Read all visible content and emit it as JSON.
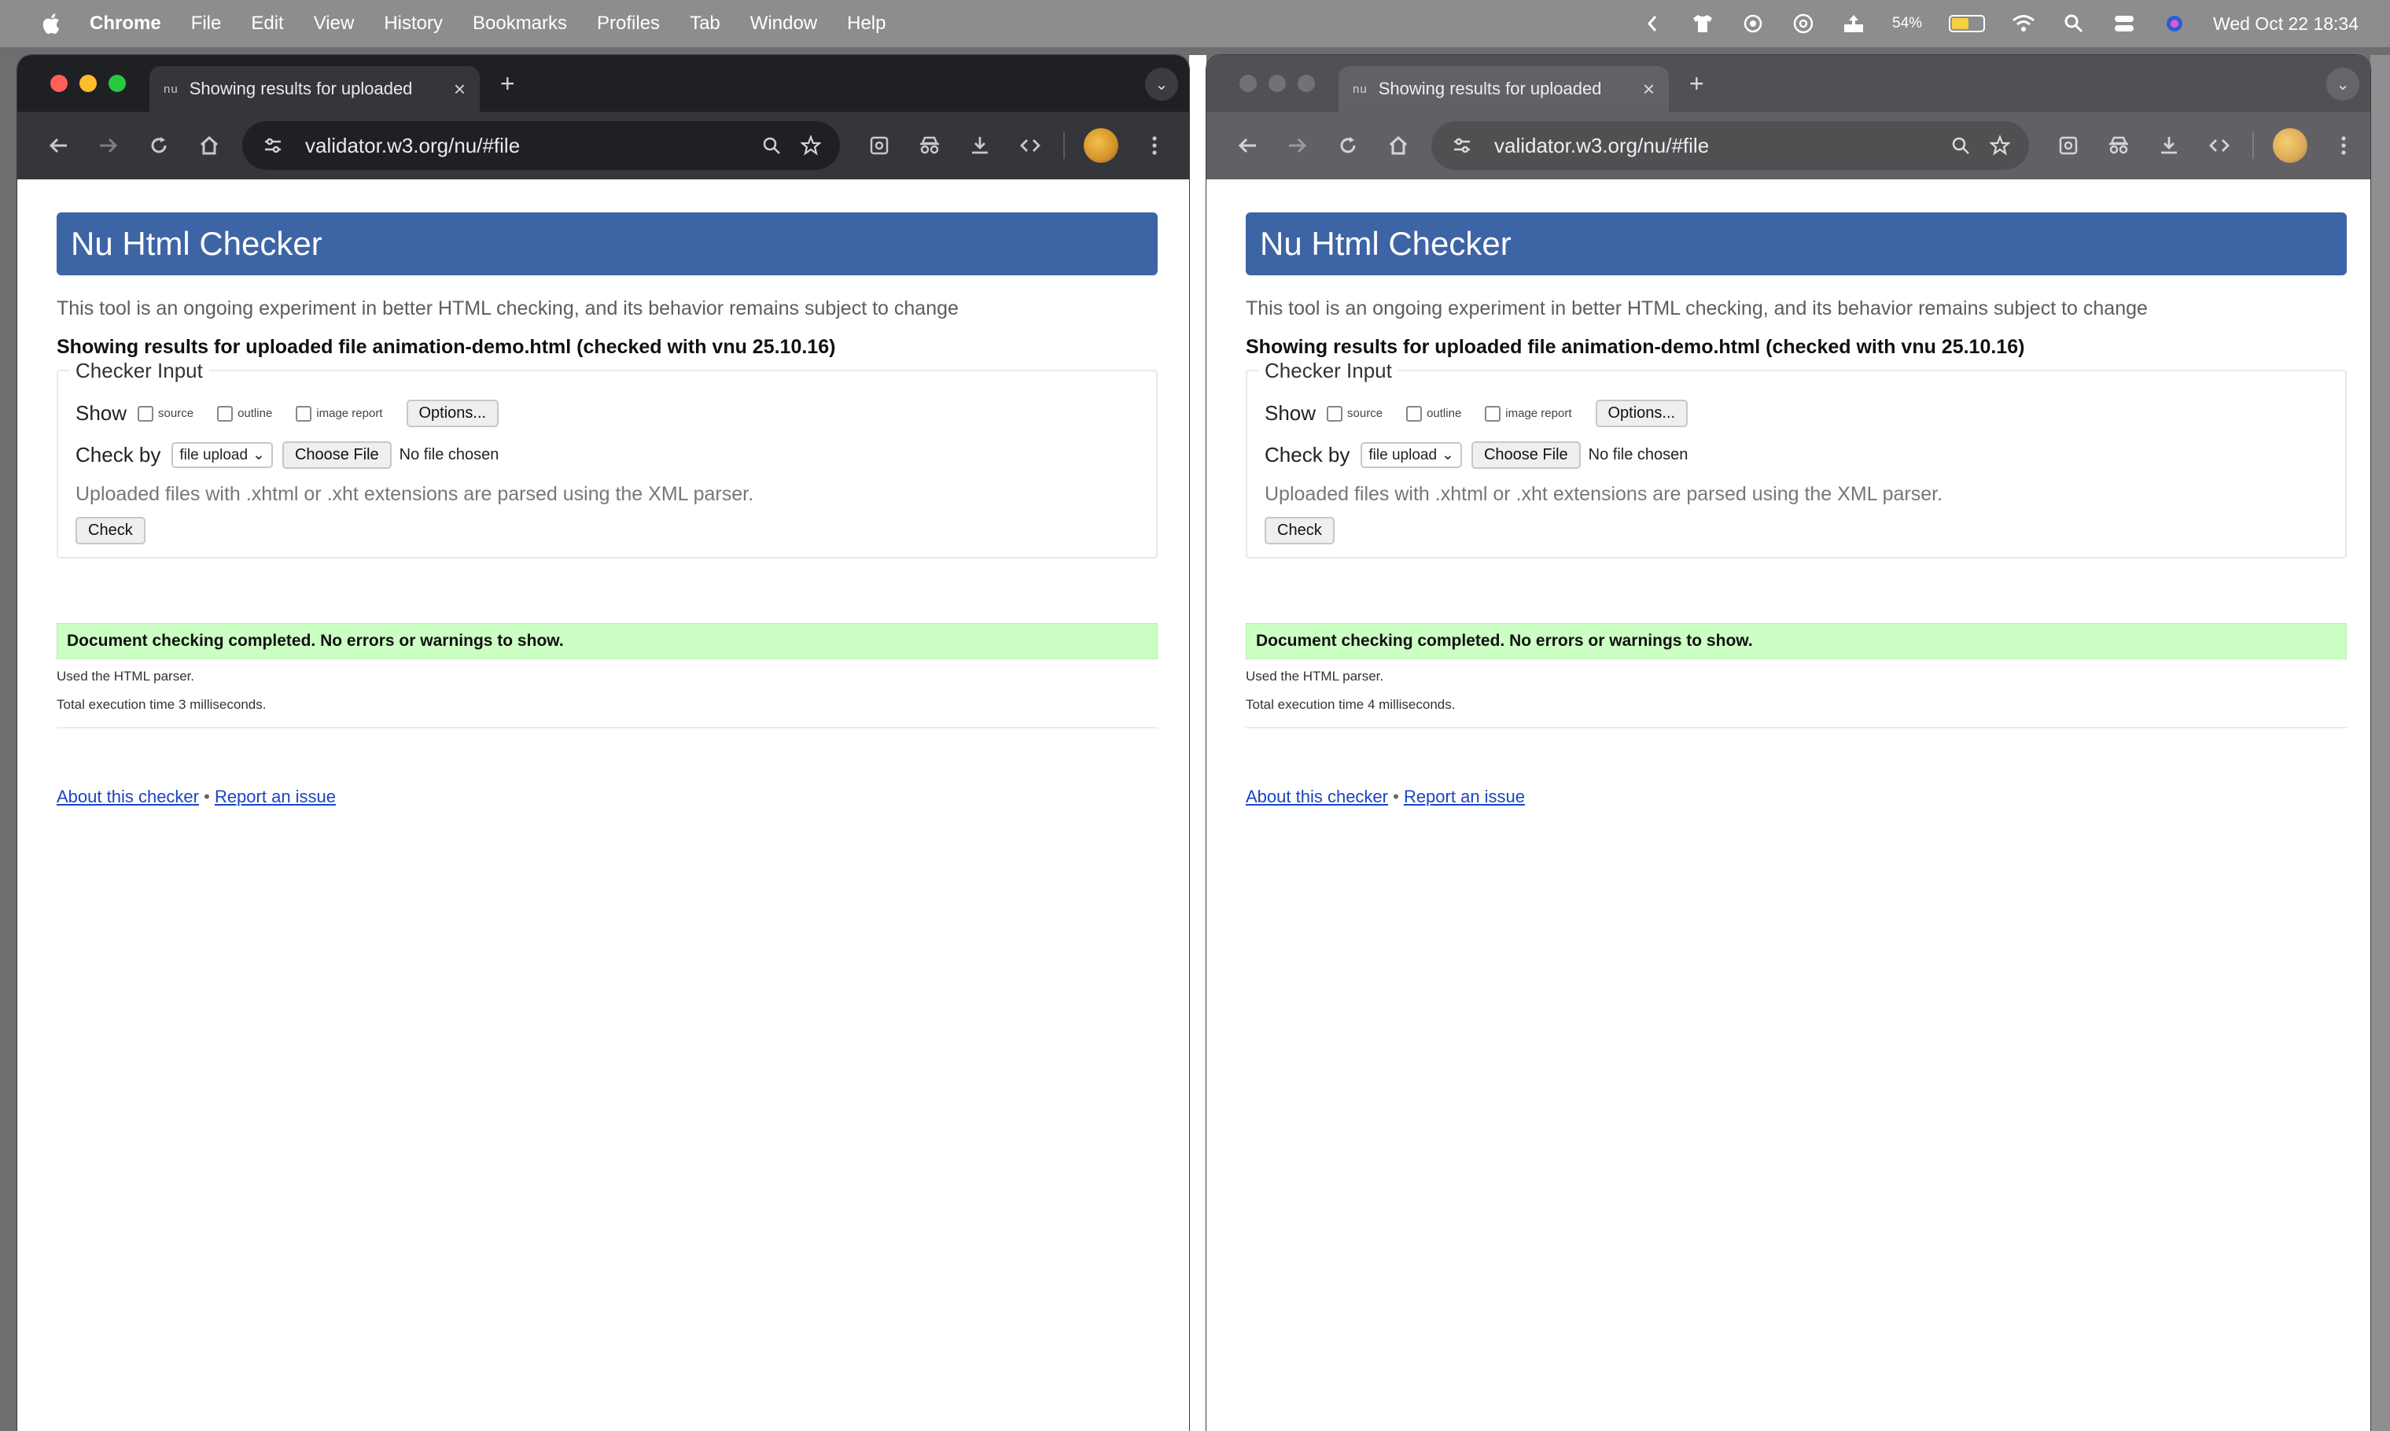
{
  "menubar": {
    "items": [
      "Chrome",
      "File",
      "Edit",
      "View",
      "History",
      "Bookmarks",
      "Profiles",
      "Tab",
      "Window",
      "Help"
    ],
    "battery_percent": "54%",
    "battery_level": 0.54,
    "clock": "Wed Oct 22  18:34"
  },
  "windows": [
    {
      "tab_favicon": "nu",
      "tab_title": "Showing results for uploaded",
      "url": "validator.w3.org/nu/#file",
      "page": {
        "banner": "Nu Html Checker",
        "intro": "This tool is an ongoing experiment in better HTML checking, and its behavior remains subject to change",
        "results_heading": "Showing results for uploaded file animation-demo.html (checked with vnu 25.10.16)",
        "legend": "Checker Input",
        "show_label": "Show",
        "checkbox_source": "source",
        "checkbox_outline": "outline",
        "checkbox_image_report": "image report",
        "options_button": "Options...",
        "checkby_label": "Check by",
        "checkby_value": "file upload",
        "choose_file": "Choose File",
        "no_file": "No file chosen",
        "hint": "Uploaded files with .xhtml or .xht extensions are parsed using the XML parser.",
        "check_button": "Check",
        "success": "Document checking completed. No errors or warnings to show.",
        "parser_note": "Used the HTML parser.",
        "exec_time": "Total execution time 3 milliseconds.",
        "about_link": "About this checker",
        "separator": "•",
        "report_link": "Report an issue"
      }
    },
    {
      "tab_favicon": "nu",
      "tab_title": "Showing results for uploaded",
      "url": "validator.w3.org/nu/#file",
      "page": {
        "banner": "Nu Html Checker",
        "intro": "This tool is an ongoing experiment in better HTML checking, and its behavior remains subject to change",
        "results_heading": "Showing results for uploaded file animation-demo.html (checked with vnu 25.10.16)",
        "legend": "Checker Input",
        "show_label": "Show",
        "checkbox_source": "source",
        "checkbox_outline": "outline",
        "checkbox_image_report": "image report",
        "options_button": "Options...",
        "checkby_label": "Check by",
        "checkby_value": "file upload",
        "choose_file": "Choose File",
        "no_file": "No file chosen",
        "hint": "Uploaded files with .xhtml or .xht extensions are parsed using the XML parser.",
        "check_button": "Check",
        "success": "Document checking completed. No errors or warnings to show.",
        "parser_note": "Used the HTML parser.",
        "exec_time": "Total execution time 4 milliseconds.",
        "about_link": "About this checker",
        "separator": "•",
        "report_link": "Report an issue"
      }
    }
  ],
  "colors": {
    "banner": "#3d64a5",
    "success_bg": "#ccffc4",
    "link": "#1a44c2",
    "traffic_close": "#ff5f57",
    "traffic_min": "#febc2e",
    "traffic_max": "#28c840",
    "traffic_inactive": "#4a4b4f"
  }
}
